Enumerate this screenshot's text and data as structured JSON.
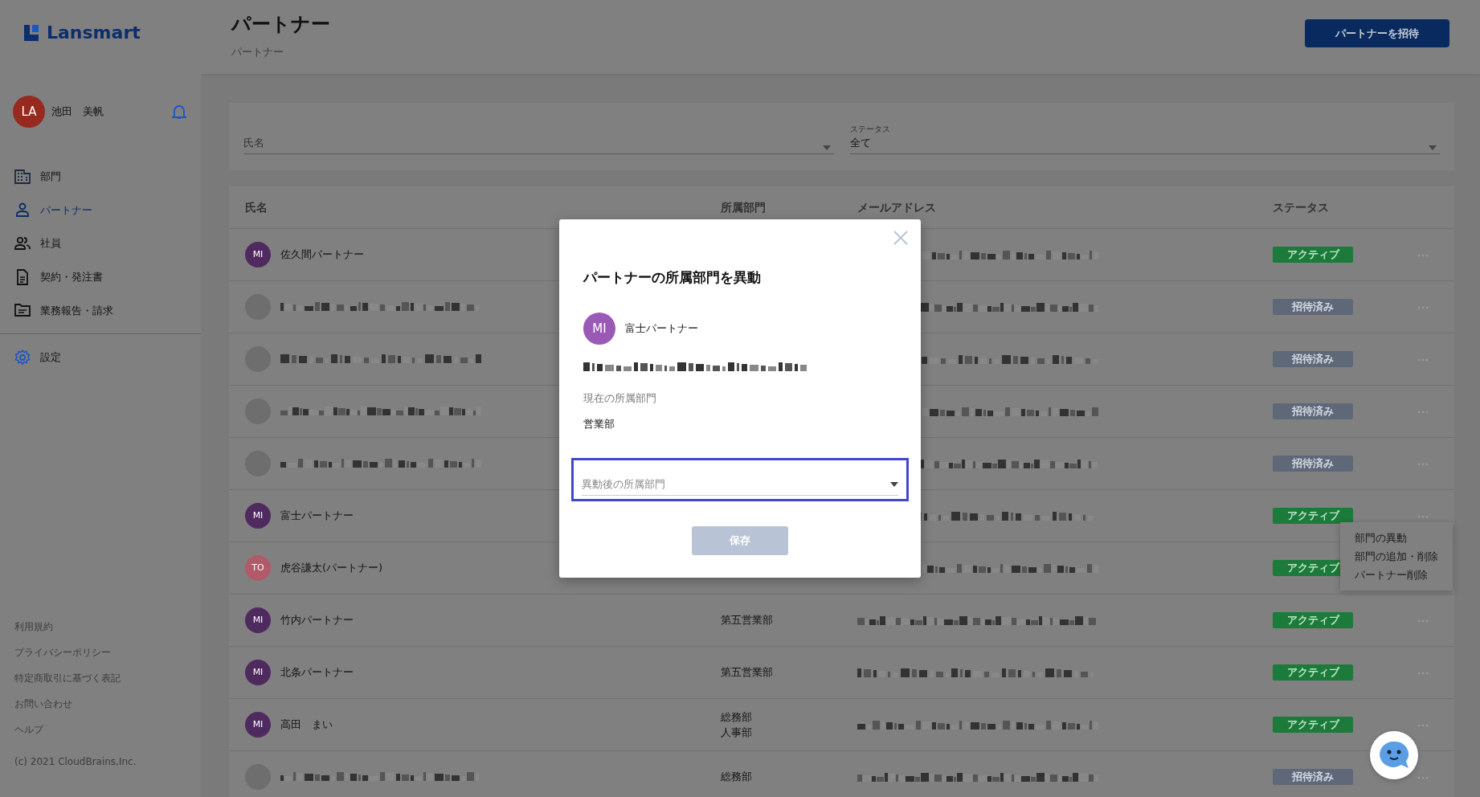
{
  "logo": {
    "text": "Lansmart"
  },
  "user": {
    "initials": "LA",
    "name": "池田　美帆",
    "color": "#962a1e"
  },
  "nav": [
    {
      "label": "部門",
      "selected": false
    },
    {
      "label": "パートナー",
      "selected": true
    },
    {
      "label": "社員",
      "selected": false
    },
    {
      "label": "契約・発注書",
      "selected": false
    },
    {
      "label": "業務報告・請求",
      "selected": false
    }
  ],
  "settings": {
    "label": "設定"
  },
  "footer_links": [
    "利用規約",
    "プライバシーポリシー",
    "特定商取引に基づく表記",
    "お問い合わせ",
    "ヘルプ"
  ],
  "copyright": "(c) 2021 CloudBrains,Inc.",
  "header": {
    "title": "パートナー",
    "breadcrumb": "パートナー",
    "invite_button": "パートナーを招待"
  },
  "filters": [
    {
      "placeholder": "氏名"
    },
    {
      "label": "ステータス",
      "value": "全て"
    }
  ],
  "table": {
    "columns": [
      "氏名",
      "所属部門",
      "メールアドレス",
      "ステータス"
    ],
    "rows": [
      {
        "initials": "MI",
        "color": "#4f2a5e",
        "name": "佐久間パートナー",
        "status": {
          "label": "アクティブ",
          "kind": "active"
        }
      },
      {
        "color": "#6e6e6e",
        "status": {
          "label": "招待済み",
          "kind": "invited"
        }
      },
      {
        "color": "#6e6e6e",
        "status": {
          "label": "招待済み",
          "kind": "invited"
        }
      },
      {
        "color": "#6e6e6e",
        "status": {
          "label": "招待済み",
          "kind": "invited"
        }
      },
      {
        "color": "#6e6e6e",
        "status": {
          "label": "招待済み",
          "kind": "invited"
        }
      },
      {
        "initials": "MI",
        "color": "#4f2a5e",
        "name": "富士パートナー",
        "status": {
          "label": "アクティブ",
          "kind": "active"
        },
        "menu": [
          "部門の異動",
          "部門の追加・削除",
          "パートナー削除"
        ]
      },
      {
        "initials": "TO",
        "color": "#b05a6a",
        "name": "虎谷謙太(パートナー)",
        "status": {
          "label": "アクティブ",
          "kind": "active"
        }
      },
      {
        "initials": "MI",
        "color": "#4f2a5e",
        "name": "竹内パートナー",
        "departments": [
          "第五営業部"
        ],
        "status": {
          "label": "アクティブ",
          "kind": "active"
        }
      },
      {
        "initials": "MI",
        "color": "#4f2a5e",
        "name": "北条パートナー",
        "departments": [
          "第五営業部"
        ],
        "status": {
          "label": "アクティブ",
          "kind": "active"
        }
      },
      {
        "initials": "MI",
        "color": "#4f2a5e",
        "name": "高田　まい",
        "departments": [
          "総務部",
          "人事部"
        ],
        "status": {
          "label": "アクティブ",
          "kind": "active"
        }
      },
      {
        "color": "#6e6e6e",
        "departments": [
          "総務部"
        ],
        "status": {
          "label": "招待済み",
          "kind": "invited"
        }
      }
    ]
  },
  "modal": {
    "title": "パートナーの所属部門を異動",
    "initials": "MI",
    "color": "#9b59b6",
    "name": "富士パートナー",
    "current_label": "現在の所属部門",
    "current_value": "営業部",
    "select": {
      "placeholder": "異動後の所属部門",
      "focused": true
    },
    "save": {
      "label": "保存",
      "disabled": true
    }
  }
}
